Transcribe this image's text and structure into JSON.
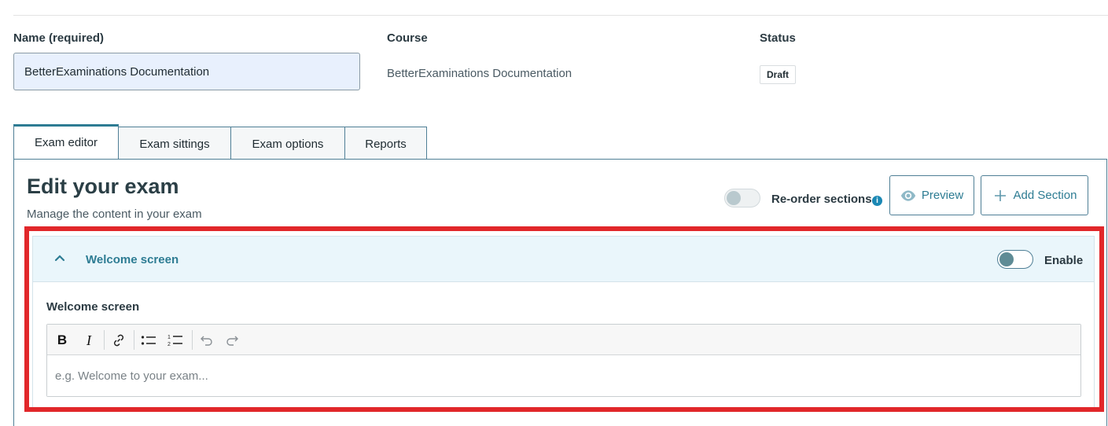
{
  "form": {
    "name_label": "Name (required)",
    "name_value": "BetterExaminations Documentation",
    "course_label": "Course",
    "course_value": "BetterExaminations Documentation",
    "status_label": "Status",
    "status_value": "Draft"
  },
  "tabs": [
    {
      "label": "Exam editor",
      "active": true
    },
    {
      "label": "Exam sittings",
      "active": false
    },
    {
      "label": "Exam options",
      "active": false
    },
    {
      "label": "Reports",
      "active": false
    }
  ],
  "editor_panel": {
    "title": "Edit your exam",
    "subtitle": "Manage the content in your exam",
    "reorder_label": "Re-order sections",
    "reorder_enabled": false,
    "preview_label": "Preview",
    "add_section_label": "Add Section"
  },
  "welcome_section": {
    "title": "Welcome screen",
    "enable_label": "Enable",
    "enabled": false,
    "field_label": "Welcome screen",
    "placeholder": "e.g. Welcome to your exam...",
    "toolbar": [
      "bold-icon",
      "italic-icon",
      "link-icon",
      "bullet-list-icon",
      "numbered-list-icon",
      "undo-icon",
      "redo-icon"
    ]
  },
  "colors": {
    "accent": "#2d7c93",
    "highlight": "#e1272a",
    "input_bg": "#e8f0fd",
    "section_header_bg": "#eaf6fb"
  }
}
